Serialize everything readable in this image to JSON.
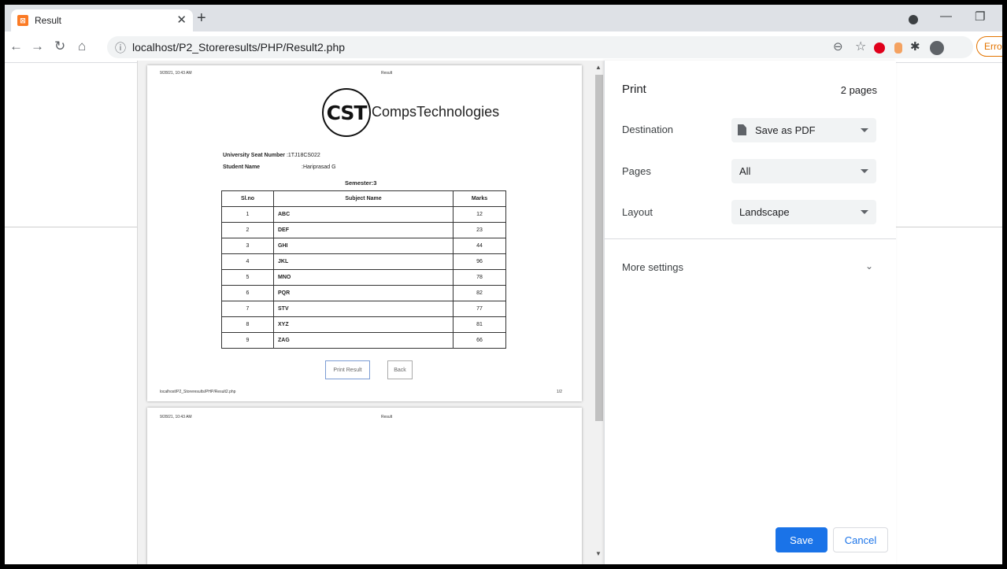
{
  "tab": {
    "title": "Result",
    "favicon": "xampp-icon"
  },
  "address": {
    "url": "localhost/P2_Storeresults/PHP/Result2.php"
  },
  "toolbar": {
    "error_label": "Erro"
  },
  "sheet": {
    "date_time": "9/28/21, 10:43 AM",
    "page_title": "Result",
    "logo_mark": "CST",
    "logo_text": "CompsTechnologies",
    "seat_label": "University Seat Number",
    "seat_value": ":1TJ18CS022",
    "name_label": "Student Name",
    "name_value": ":Hariprasad G",
    "semester": "Semester:3",
    "table": {
      "headers": [
        "Sl.no",
        "Subject Name",
        "Marks"
      ],
      "rows": [
        [
          "1",
          "ABC",
          "12"
        ],
        [
          "2",
          "DEF",
          "23"
        ],
        [
          "3",
          "GHI",
          "44"
        ],
        [
          "4",
          "JKL",
          "96"
        ],
        [
          "5",
          "MNO",
          "78"
        ],
        [
          "6",
          "PQR",
          "82"
        ],
        [
          "7",
          "STV",
          "77"
        ],
        [
          "8",
          "XYZ",
          "81"
        ],
        [
          "9",
          "ZAG",
          "66"
        ]
      ]
    },
    "print_button": "Print Result",
    "back_button": "Back",
    "footer_url": "localhost/P2_Storeresults/PHP/Result2.php",
    "page_num": "1/2"
  },
  "panel": {
    "title": "Print",
    "page_count": "2 pages",
    "destination_label": "Destination",
    "destination_value": "Save as PDF",
    "pages_label": "Pages",
    "pages_value": "All",
    "layout_label": "Layout",
    "layout_value": "Landscape",
    "more_settings": "More settings",
    "save": "Save",
    "cancel": "Cancel"
  },
  "colors": {
    "accent": "#1a73e8",
    "favicon": "#fb7a24",
    "error": "#e37400"
  }
}
